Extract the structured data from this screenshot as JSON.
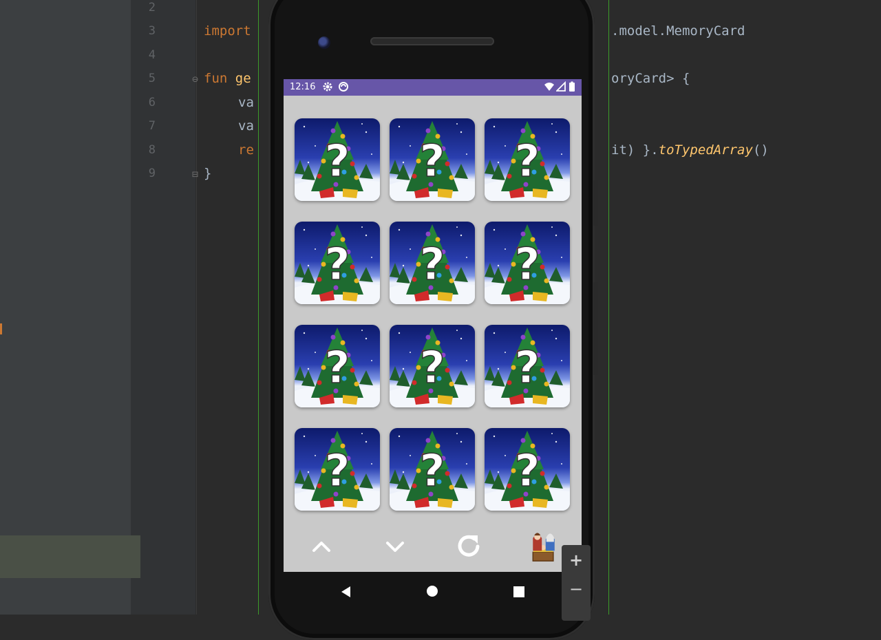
{
  "editor": {
    "line_numbers": [
      "2",
      "3",
      "4",
      "5",
      "6",
      "7",
      "8",
      "9"
    ],
    "lines": {
      "l3_kw": "import",
      "l3_rest": ".model.MemoryCard",
      "l5_kw": "fun",
      "l5_fn": " ge",
      "l5_rest": "oryCard> {",
      "l6": "va",
      "l7": "va",
      "l8_kw": "re",
      "l8_mid": "it) }.",
      "l8_fn": "toTypedArray",
      "l8_end": "()",
      "l9": "}"
    }
  },
  "status_bar": {
    "time": "12:16",
    "icons": [
      "gear-icon",
      "sync-icon",
      "wifi-icon",
      "signal-icon",
      "battery-icon"
    ],
    "color": "#6756a8"
  },
  "game": {
    "cards": [
      {
        "face": "?"
      },
      {
        "face": "?"
      },
      {
        "face": "?"
      },
      {
        "face": "?"
      },
      {
        "face": "?"
      },
      {
        "face": "?"
      },
      {
        "face": "?"
      },
      {
        "face": "?"
      },
      {
        "face": "?"
      },
      {
        "face": "?"
      },
      {
        "face": "?"
      },
      {
        "face": "?"
      }
    ],
    "card_background": "christmas-tree",
    "controls": [
      "chevron-up-icon",
      "chevron-down-icon",
      "refresh-icon",
      "nativity-icon"
    ]
  },
  "nav": {
    "buttons": [
      "back-icon",
      "home-icon",
      "recents-icon"
    ]
  },
  "zoom": {
    "plus": "+",
    "minus": "−"
  }
}
